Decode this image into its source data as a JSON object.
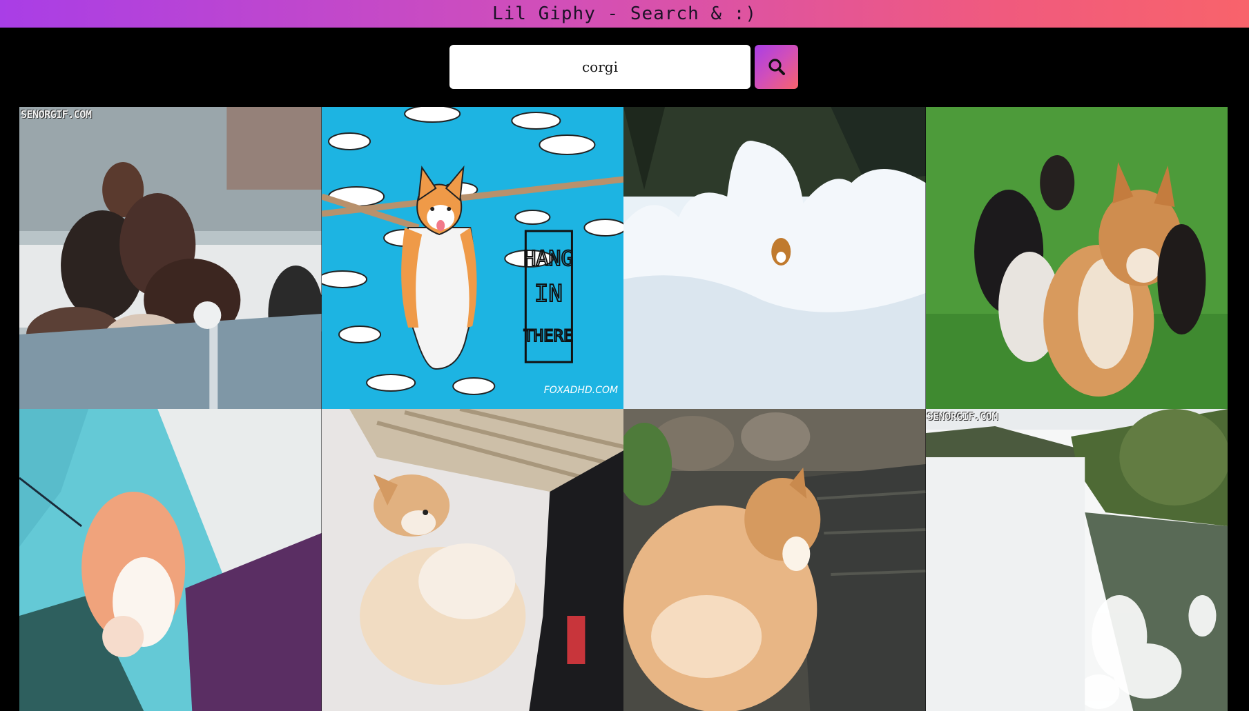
{
  "header": {
    "title": "Lil Giphy - Search & :)"
  },
  "search": {
    "value": "corgi"
  },
  "results": [
    {
      "name": "gif-puppies-playpen",
      "watermark": "SENORGIF.COM"
    },
    {
      "name": "gif-corgi-hang-in-there",
      "art_text": [
        "HANG",
        "IN",
        "THERE"
      ],
      "signature": "FOXADHD.COM"
    },
    {
      "name": "gif-corgi-snow"
    },
    {
      "name": "gif-corgis-running-grass"
    },
    {
      "name": "gif-corgi-tent"
    },
    {
      "name": "gif-corgi-bed"
    },
    {
      "name": "gif-corgi-water-rocks"
    },
    {
      "name": "gif-corgi-lake-splash",
      "watermark": "SENORGIF.COM"
    }
  ],
  "colors": {
    "header_gradient": [
      "#a93ee6",
      "#f8636b"
    ],
    "background": "#000000"
  }
}
